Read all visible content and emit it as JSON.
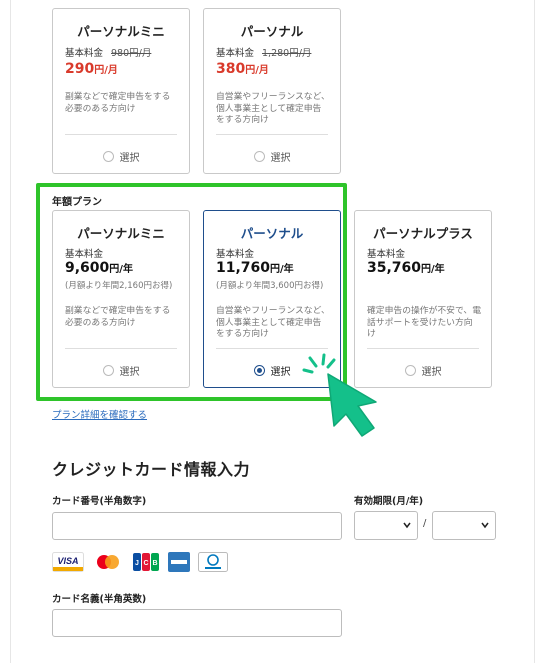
{
  "monthly_plans": [
    {
      "title": "パーソナルミニ",
      "fee_label": "基本料金",
      "old_price": "980円/月",
      "price": "290",
      "unit": "円/月",
      "desc": "副業などで確定申告をする必要のある方向け",
      "select_label": "選択"
    },
    {
      "title": "パーソナル",
      "fee_label": "基本料金",
      "old_price": "1,280円/月",
      "price": "380",
      "unit": "円/月",
      "desc": "自営業やフリーランスなど、個人事業主として確定申告をする方向け",
      "select_label": "選択"
    }
  ],
  "annual_label": "年額プラン",
  "annual_plans": [
    {
      "title": "パーソナルミニ",
      "fee_label": "基本料金",
      "price": "9,600",
      "unit": "円/年",
      "note": "(月額より年間2,160円お得)",
      "desc": "副業などで確定申告をする必要のある方向け",
      "select_label": "選択",
      "selected": false
    },
    {
      "title": "パーソナル",
      "fee_label": "基本料金",
      "price": "11,760",
      "unit": "円/年",
      "note": "(月額より年間3,600円お得)",
      "desc": "自営業やフリーランスなど、個人事業主として確定申告をする方向け",
      "select_label": "選択",
      "selected": true
    },
    {
      "title": "パーソナルプラス",
      "fee_label": "基本料金",
      "price": "35,760",
      "unit": "円/年",
      "note": "",
      "desc": "確定申告の操作が不安で、電話サポートを受けたい方向け",
      "select_label": "選択",
      "selected": false
    }
  ],
  "plan_details_link": "プラン詳細を確認する",
  "credit_section": {
    "title": "クレジットカード情報入力",
    "card_number_label": "カード番号(半角数字)",
    "expiry_label": "有効期限(月/年)",
    "expiry_separator": "/",
    "card_name_label": "カード名義(半角英数)",
    "brands": [
      "VISA",
      "Mastercard",
      "JCB",
      "American Express",
      "Diners Club"
    ]
  },
  "colors": {
    "highlight": "#2ec42a",
    "selected": "#1f4e8c",
    "price_red": "#d93a2b",
    "cursor": "#14c08a"
  }
}
